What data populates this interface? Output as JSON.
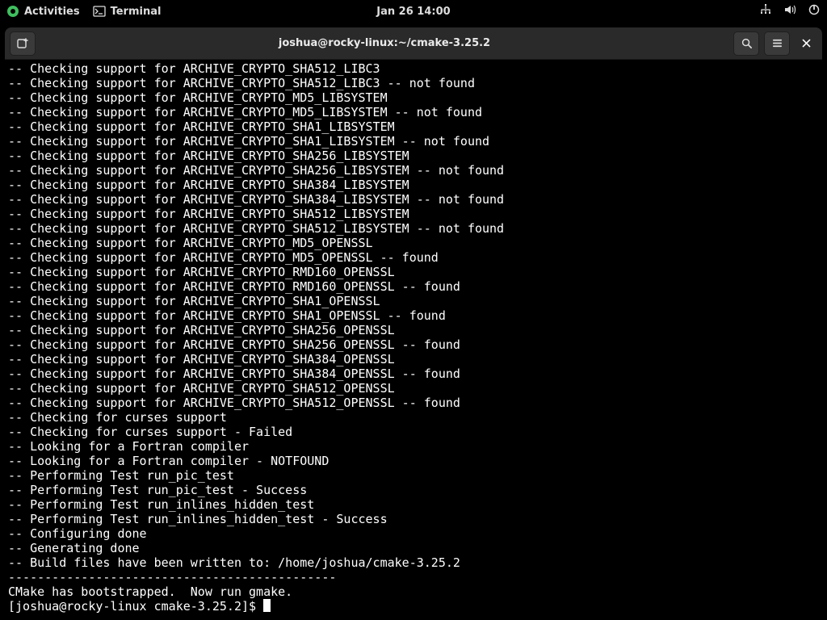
{
  "topbar": {
    "activities": "Activities",
    "terminal": "Terminal",
    "clock": "Jan 26  14:00"
  },
  "window": {
    "title": "joshua@rocky-linux:~/cmake-3.25.2"
  },
  "terminal": {
    "lines": [
      "-- Checking support for ARCHIVE_CRYPTO_SHA512_LIBC3",
      "-- Checking support for ARCHIVE_CRYPTO_SHA512_LIBC3 -- not found",
      "-- Checking support for ARCHIVE_CRYPTO_MD5_LIBSYSTEM",
      "-- Checking support for ARCHIVE_CRYPTO_MD5_LIBSYSTEM -- not found",
      "-- Checking support for ARCHIVE_CRYPTO_SHA1_LIBSYSTEM",
      "-- Checking support for ARCHIVE_CRYPTO_SHA1_LIBSYSTEM -- not found",
      "-- Checking support for ARCHIVE_CRYPTO_SHA256_LIBSYSTEM",
      "-- Checking support for ARCHIVE_CRYPTO_SHA256_LIBSYSTEM -- not found",
      "-- Checking support for ARCHIVE_CRYPTO_SHA384_LIBSYSTEM",
      "-- Checking support for ARCHIVE_CRYPTO_SHA384_LIBSYSTEM -- not found",
      "-- Checking support for ARCHIVE_CRYPTO_SHA512_LIBSYSTEM",
      "-- Checking support for ARCHIVE_CRYPTO_SHA512_LIBSYSTEM -- not found",
      "-- Checking support for ARCHIVE_CRYPTO_MD5_OPENSSL",
      "-- Checking support for ARCHIVE_CRYPTO_MD5_OPENSSL -- found",
      "-- Checking support for ARCHIVE_CRYPTO_RMD160_OPENSSL",
      "-- Checking support for ARCHIVE_CRYPTO_RMD160_OPENSSL -- found",
      "-- Checking support for ARCHIVE_CRYPTO_SHA1_OPENSSL",
      "-- Checking support for ARCHIVE_CRYPTO_SHA1_OPENSSL -- found",
      "-- Checking support for ARCHIVE_CRYPTO_SHA256_OPENSSL",
      "-- Checking support for ARCHIVE_CRYPTO_SHA256_OPENSSL -- found",
      "-- Checking support for ARCHIVE_CRYPTO_SHA384_OPENSSL",
      "-- Checking support for ARCHIVE_CRYPTO_SHA384_OPENSSL -- found",
      "-- Checking support for ARCHIVE_CRYPTO_SHA512_OPENSSL",
      "-- Checking support for ARCHIVE_CRYPTO_SHA512_OPENSSL -- found",
      "-- Checking for curses support",
      "-- Checking for curses support - Failed",
      "-- Looking for a Fortran compiler",
      "-- Looking for a Fortran compiler - NOTFOUND",
      "-- Performing Test run_pic_test",
      "-- Performing Test run_pic_test - Success",
      "-- Performing Test run_inlines_hidden_test",
      "-- Performing Test run_inlines_hidden_test - Success",
      "-- Configuring done",
      "-- Generating done",
      "-- Build files have been written to: /home/joshua/cmake-3.25.2",
      "---------------------------------------------",
      "CMake has bootstrapped.  Now run gmake."
    ],
    "prompt": "[joshua@rocky-linux cmake-3.25.2]$ "
  }
}
